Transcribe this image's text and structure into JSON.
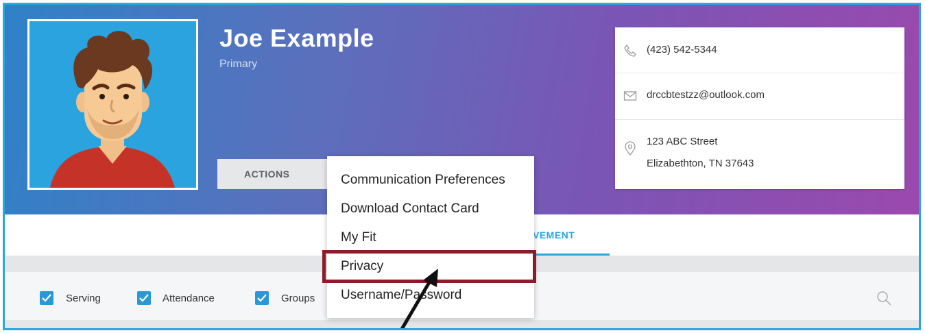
{
  "profile": {
    "name": "Joe Example",
    "subtitle": "Primary"
  },
  "actions_label": "ACTIONS",
  "contact": {
    "phone": "(423) 542-5344",
    "email": "drccbtestzz@outlook.com",
    "address_line1": "123 ABC Street",
    "address_line2": "Elizabethton, TN 37643"
  },
  "tabs": {
    "active_partial_label": "VEMENT"
  },
  "filters": [
    {
      "label": "Serving",
      "checked": true
    },
    {
      "label": "Attendance",
      "checked": true
    },
    {
      "label": "Groups",
      "checked": true
    }
  ],
  "menu": {
    "items": [
      "Communication Preferences",
      "Download Contact Card",
      "My Fit",
      "Privacy",
      "Username/Password"
    ]
  },
  "colors": {
    "accent": "#29a6df",
    "highlight_border": "#8e1b2b",
    "checkbox": "#2a98d6"
  }
}
